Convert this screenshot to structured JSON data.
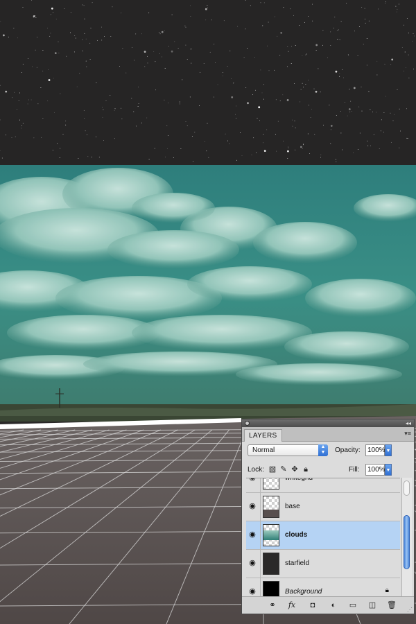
{
  "canvas": {
    "regions": [
      "starfield",
      "clouds",
      "grid-floor"
    ],
    "colors": {
      "space": "#262525",
      "sky_top": "#2f8f8a",
      "sky_bottom": "#3f7e70",
      "ground": "#584f4e",
      "grid_line": "#d8d8d8",
      "horizon_land": "#3a4634"
    }
  },
  "layers_panel": {
    "tab_label": "LAYERS",
    "blend_mode": "Normal",
    "opacity_label": "Opacity:",
    "opacity_value": "100%",
    "lock_label": "Lock:",
    "fill_label": "Fill:",
    "fill_value": "100%",
    "lock_icons": [
      "checkerboard-icon",
      "brush-icon",
      "move-icon",
      "padlock-icon"
    ],
    "layers": [
      {
        "name": "whitegrid",
        "visible": true,
        "thumb": "transparent",
        "selected": false,
        "locked": false
      },
      {
        "name": "base",
        "visible": true,
        "thumb": "transparent-with-ground",
        "selected": false,
        "locked": false
      },
      {
        "name": "clouds",
        "visible": true,
        "thumb": "clouds",
        "selected": true,
        "locked": false
      },
      {
        "name": "starfield",
        "visible": true,
        "thumb": "dark",
        "selected": false,
        "locked": false
      },
      {
        "name": "Background",
        "visible": true,
        "thumb": "black",
        "selected": false,
        "locked": true
      }
    ],
    "footer_icons": [
      "link-layers-icon",
      "fx-icon",
      "mask-icon",
      "adjustment-icon",
      "group-folder-icon",
      "new-layer-icon",
      "trash-icon"
    ],
    "fx_label": "fx"
  }
}
